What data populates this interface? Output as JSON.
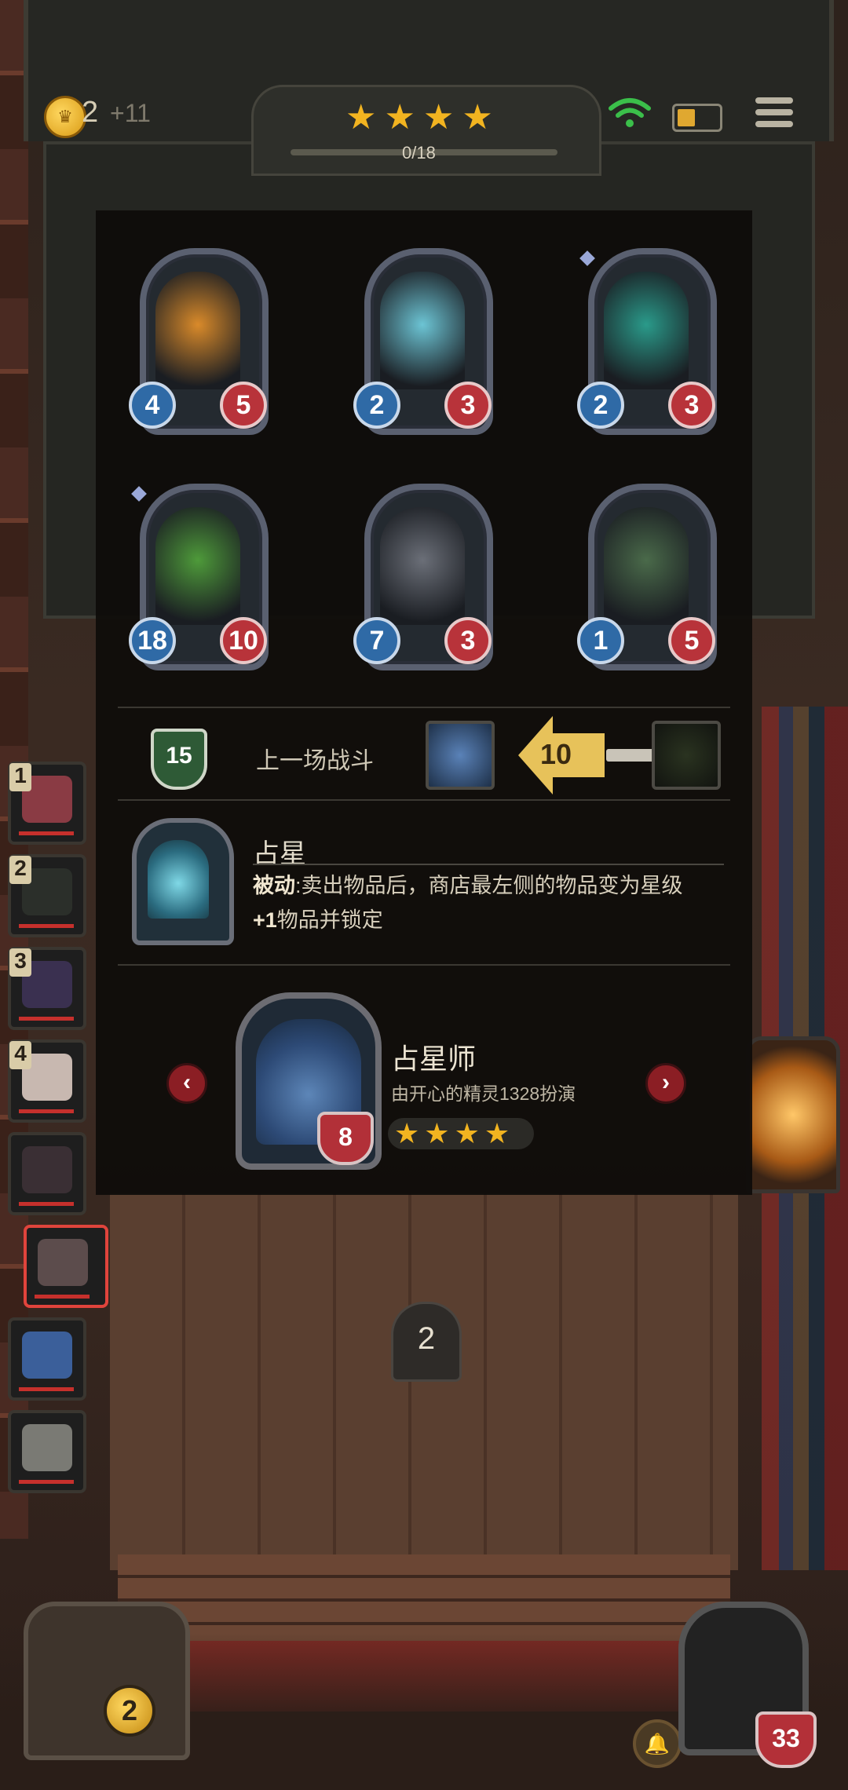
{
  "hud": {
    "gold": "2",
    "gold_income": "+11",
    "star_rating": 4,
    "progress_text": "0/18"
  },
  "roster": [
    {
      "number": "1",
      "face_color": "#8a3b44"
    },
    {
      "number": "2",
      "face_color": "#2b2f2a"
    },
    {
      "number": "3",
      "face_color": "#3a3050"
    },
    {
      "number": "4",
      "face_color": "#c8b8b0"
    },
    {
      "number": "",
      "face_color": "#3a2f34"
    },
    {
      "number": "",
      "face_color": "#5c4c4c"
    },
    {
      "number": "",
      "face_color": "#3b5f9a"
    },
    {
      "number": "",
      "face_color": "#7a7a74"
    }
  ],
  "board_cards": [
    {
      "name": "pumpkin",
      "attack": "4",
      "health": "5",
      "art_color": "#d98a2a",
      "diamond": false
    },
    {
      "name": "fish-tank",
      "attack": "2",
      "health": "3",
      "art_color": "#6cc4d4",
      "diamond": false
    },
    {
      "name": "demon-cauldron",
      "attack": "2",
      "health": "3",
      "art_color": "#2a9a8a",
      "diamond": true
    },
    {
      "name": "leaf-girl",
      "attack": "18",
      "health": "10",
      "art_color": "#4e9a3a",
      "diamond": true
    },
    {
      "name": "robot-box",
      "attack": "7",
      "health": "3",
      "art_color": "#6b6f78",
      "diamond": false
    },
    {
      "name": "venus-plant",
      "attack": "1",
      "health": "5",
      "art_color": "#4a6a4a",
      "diamond": false
    }
  ],
  "last_battle": {
    "level": "15",
    "label": "上一场战斗",
    "damage": "10"
  },
  "ability": {
    "name": "占星",
    "desc_bold": "被动",
    "desc_text": ":卖出物品后，商店最左侧的物品变为星级",
    "desc_line2_bold": "+1",
    "desc_line2_text": "物品并锁定"
  },
  "hero": {
    "name": "占星师",
    "credit": "由开心的精灵1328扮演",
    "health": "8",
    "stars": 4
  },
  "floor": {
    "bell_number": "2",
    "reroll_cost": "2",
    "player_hp": "33"
  }
}
